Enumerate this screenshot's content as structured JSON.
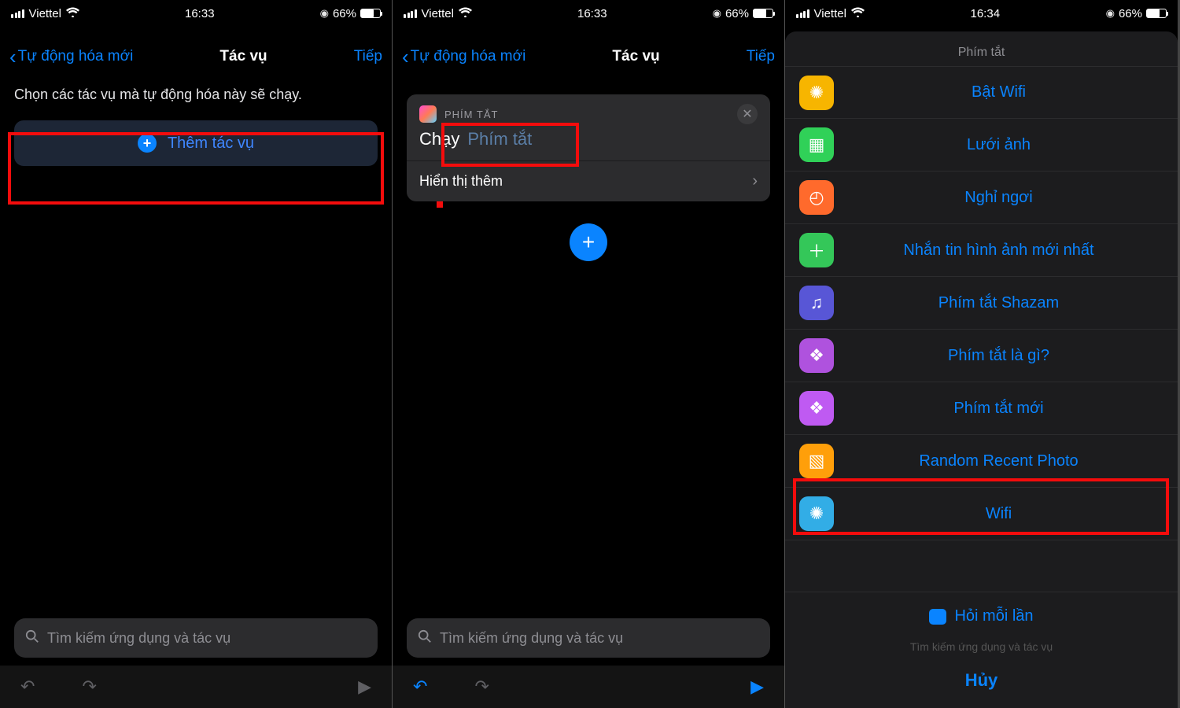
{
  "status": {
    "carrier": "Viettel",
    "battery": "66%",
    "time_a": "16:33",
    "time_b": "16:33",
    "time_c": "16:34"
  },
  "screen1": {
    "back_label": "Tự động hóa mới",
    "title": "Tác vụ",
    "next": "Tiếp",
    "subtitle": "Chọn các tác vụ mà tự động hóa này sẽ chạy.",
    "add_action": "Thêm tác vụ",
    "search_placeholder": "Tìm kiếm ứng dụng và tác vụ"
  },
  "screen2": {
    "back_label": "Tự động hóa mới",
    "title": "Tác vụ",
    "next": "Tiếp",
    "card_header": "PHÍM TẮT",
    "run_label": "Chạy",
    "run_placeholder": "Phím tắt",
    "show_more": "Hiển thị thêm",
    "search_placeholder": "Tìm kiếm ứng dụng và tác vụ"
  },
  "screen3": {
    "sheet_title": "Phím tắt",
    "items": [
      {
        "label": "Bật Wifi",
        "color": "c-yellow",
        "glyph": "✺"
      },
      {
        "label": "Lưới ảnh",
        "color": "c-green",
        "glyph": "▦"
      },
      {
        "label": "Nghỉ ngơi",
        "color": "c-orange",
        "glyph": "◴"
      },
      {
        "label": "Nhắn tin hình ảnh mới nhất",
        "color": "c-green2",
        "glyph": "＋"
      },
      {
        "label": "Phím tắt Shazam",
        "color": "c-indigo",
        "glyph": "♫"
      },
      {
        "label": "Phím tắt là gì?",
        "color": "c-purple",
        "glyph": "❖"
      },
      {
        "label": "Phím tắt mới",
        "color": "c-purple2",
        "glyph": "❖"
      },
      {
        "label": "Random Recent Photo",
        "color": "c-amber",
        "glyph": "▧"
      },
      {
        "label": "Wifi",
        "color": "c-teal",
        "glyph": "✺"
      }
    ],
    "ask_each_time": "Hỏi mỗi lần",
    "hint": "Tìm kiếm ứng dụng và tác vụ",
    "cancel": "Hủy"
  }
}
